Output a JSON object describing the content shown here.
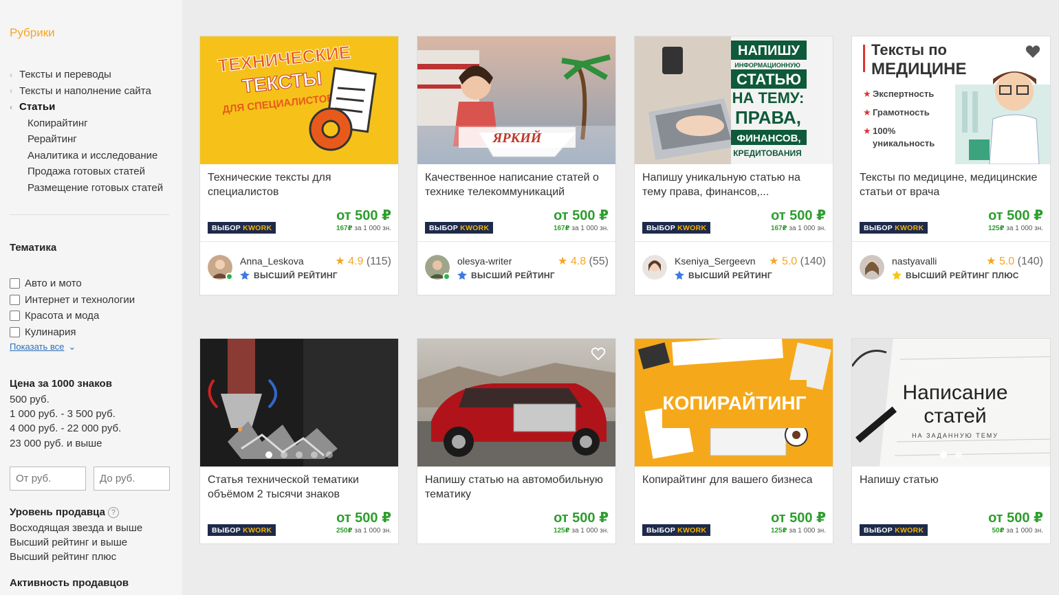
{
  "sidebar": {
    "rubrics_title": "Рубрики",
    "rubrics": [
      {
        "label": "Тексты и переводы"
      },
      {
        "label": "Тексты и наполнение сайта"
      },
      {
        "label": "Статьи"
      }
    ],
    "subrubrics": [
      {
        "label": "Копирайтинг"
      },
      {
        "label": "Рерайтинг"
      },
      {
        "label": "Аналитика и исследование"
      },
      {
        "label": "Продажа готовых статей"
      },
      {
        "label": "Размещение готовых статей"
      }
    ],
    "theme_title": "Тематика",
    "themes": [
      {
        "label": "Авто и мото",
        "checked": false
      },
      {
        "label": "Интернет и технологии",
        "checked": false
      },
      {
        "label": "Красота и мода",
        "checked": false
      },
      {
        "label": "Кулинария",
        "checked": false
      }
    ],
    "show_all": "Показать все",
    "price_title": "Цена за 1000 знаков",
    "prices": [
      {
        "label": "500 руб."
      },
      {
        "label": "1 000 руб. - 3 500 руб."
      },
      {
        "label": "4 000 руб. - 22 000 руб."
      },
      {
        "label": "23 000 руб. и выше"
      }
    ],
    "price_from_placeholder": "От руб.",
    "price_to_placeholder": "До руб.",
    "level_title": "Уровень продавца",
    "help_symbol": "?",
    "levels": [
      {
        "label": "Восходящая звезда и выше"
      },
      {
        "label": "Высший рейтинг и выше"
      },
      {
        "label": "Высший рейтинг плюс"
      }
    ],
    "activity_title": "Активность продавцов"
  },
  "badge": {
    "prefix": "ВЫБОР",
    "brand": "KWORK"
  },
  "cards": [
    {
      "title": "Технические тексты для специалистов",
      "price": "от 500 ₽",
      "per_value": "167₽",
      "per_text": "за 1 000 зн.",
      "image_text_1": "ТЕХНИЧЕСКИЕ",
      "image_text_2": "ТЕКСТЫ",
      "image_text_3": "ДЛЯ СПЕЦИАЛИСТОВ",
      "seller": "Anna_Leskova",
      "rating_value": "4.9",
      "rating_count": "(115)",
      "level": "ВЫСШИЙ РЕЙТИНГ",
      "online": true
    },
    {
      "title": "Качественное написание статей о технике телекоммуникаций",
      "price": "от 500 ₽",
      "per_value": "167₽",
      "per_text": "за 1 000 зн.",
      "image_text_1": "ЯРКИЙ",
      "seller": "olesya-writer",
      "rating_value": "4.8",
      "rating_count": "(55)",
      "level": "ВЫСШИЙ РЕЙТИНГ",
      "online": true
    },
    {
      "title": "Напишу уникальную статью на тему права, финансов,...",
      "price": "от 500 ₽",
      "per_value": "167₽",
      "per_text": "за 1 000 зн.",
      "image_text_1": "НАПИШУ",
      "image_text_2": "ИНФОРМАЦИОННУЮ",
      "image_text_3": "СТАТЬЮ",
      "image_text_4": "НА ТЕМУ:",
      "image_text_5": "ПРАВА,",
      "image_text_6": "ФИНАНСОВ,",
      "image_text_7": "КРЕДИТОВАНИЯ",
      "seller": "Kseniya_Sergeevn",
      "rating_value": "5.0",
      "rating_count": "(140)",
      "level": "ВЫСШИЙ РЕЙТИНГ",
      "online": false
    },
    {
      "title": "Тексты по медицине, медицинские статьи от врача",
      "price": "от 500 ₽",
      "per_value": "125₽",
      "per_text": "за 1 000 зн.",
      "image_text_1": "Тексты по",
      "image_text_2": "МЕДИЦИНЕ",
      "image_text_3": "Экспертность",
      "image_text_4": "Грамотность",
      "image_text_5": "100%",
      "image_text_6": "уникальность",
      "seller": "nastyavalli",
      "rating_value": "5.0",
      "rating_count": "(140)",
      "level": "ВЫСШИЙ РЕЙТИНГ ПЛЮС",
      "online": false
    },
    {
      "title": "Статья технической тематики объёмом 2 тысячи знаков",
      "price": "от 500 ₽",
      "per_value": "250₽",
      "per_text": "за 1 000 зн."
    },
    {
      "title": "Напишу статью на автомобильную тематику",
      "price": "от 500 ₽",
      "per_value": "125₽",
      "per_text": "за 1 000 зн."
    },
    {
      "title": "Копирайтинг для вашего бизнеса",
      "price": "от 500 ₽",
      "per_value": "125₽",
      "per_text": "за 1 000 зн.",
      "image_text_1": "КОПИРАЙТИНГ"
    },
    {
      "title": "Напишу статью",
      "price": "от 500 ₽",
      "per_value": "50₽",
      "per_text": "за 1 000 зн.",
      "image_text_1": "Написание",
      "image_text_2": "статей",
      "image_text_3": "НА ЗАДАННУЮ ТЕМУ"
    }
  ],
  "colors": {
    "accent_orange": "#f5a623",
    "price_green": "#2e9e2e",
    "badge_navy": "#1e2a4a",
    "link_blue": "#2a6ebb"
  }
}
